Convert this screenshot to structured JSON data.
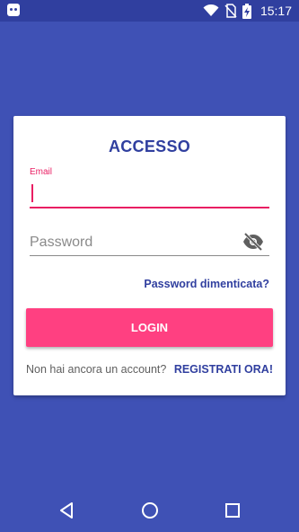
{
  "status_bar": {
    "time": "15:17",
    "icons": [
      "android-app-icon",
      "wifi-icon",
      "no-sim-icon",
      "battery-charging-icon"
    ]
  },
  "card": {
    "title": "ACCESSO",
    "email": {
      "label": "Email",
      "value": ""
    },
    "password": {
      "placeholder": "Password",
      "value": ""
    },
    "forgot_password": "Password dimenticata?",
    "login_button": "LOGIN",
    "register_prompt": "Non hai ancora un account?",
    "register_link": "REGISTRATI ORA!"
  },
  "nav_bar": {
    "icons": [
      "back-icon",
      "home-icon",
      "recents-icon"
    ]
  },
  "colors": {
    "background": "#3f51b5",
    "status_bar": "#303f9f",
    "accent": "#ff4081",
    "focus": "#e91e63",
    "primary_text": "#303f9f"
  }
}
